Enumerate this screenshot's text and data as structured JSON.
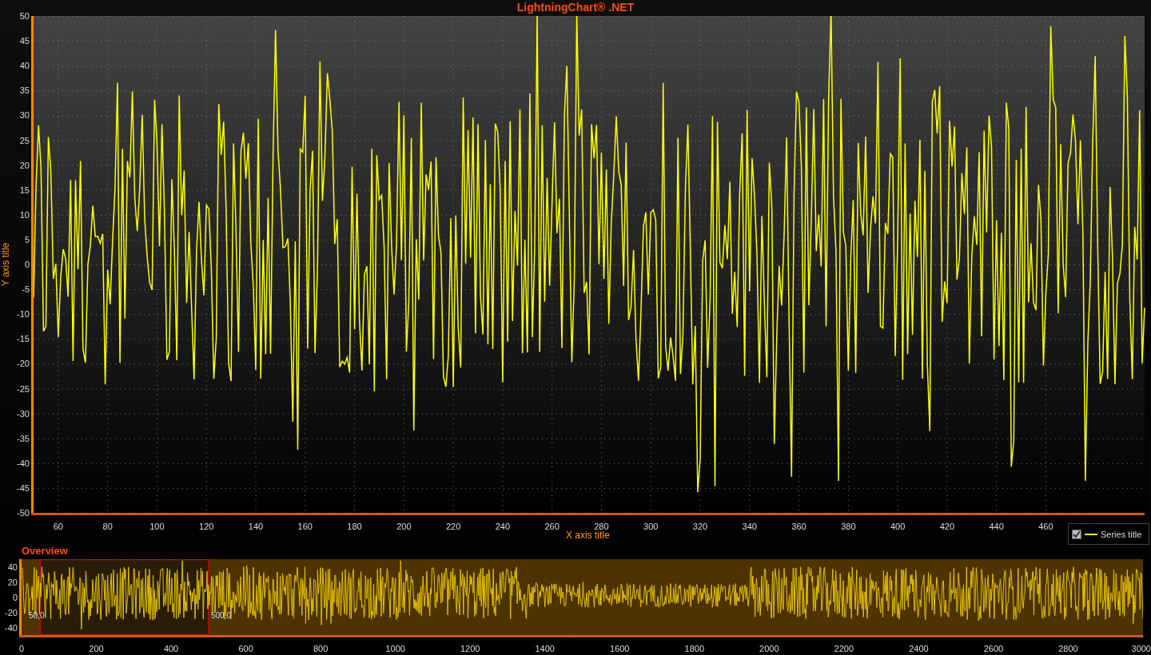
{
  "chart": {
    "title": "LightningChart® .NET",
    "x_axis": {
      "title": "X axis title",
      "ticks": [
        "60",
        "80",
        "100",
        "120",
        "140",
        "160",
        "180",
        "200",
        "220",
        "240",
        "260",
        "280",
        "300",
        "320",
        "340",
        "360",
        "380",
        "400",
        "420",
        "440",
        "460"
      ]
    },
    "y_axis": {
      "title": "Y axis title",
      "ticks": [
        "50",
        "45",
        "40",
        "35",
        "30",
        "25",
        "20",
        "15",
        "10",
        "5",
        "0",
        "-5",
        "-10",
        "-15",
        "-20",
        "-25",
        "-30",
        "-35",
        "-40",
        "-45",
        "-50"
      ]
    }
  },
  "legend": {
    "series_title": "Series title",
    "checked": true
  },
  "overview": {
    "title": "Overview",
    "y_ticks": [
      "40",
      "20",
      "0",
      "-20",
      "-40"
    ],
    "x_ticks": [
      "0",
      "200",
      "400",
      "600",
      "800",
      "1000",
      "1200",
      "1400",
      "1600",
      "1800",
      "2000",
      "2200",
      "2400",
      "2600",
      "2800",
      "3000"
    ],
    "range_start": "50,0",
    "range_end": "500,0"
  }
}
